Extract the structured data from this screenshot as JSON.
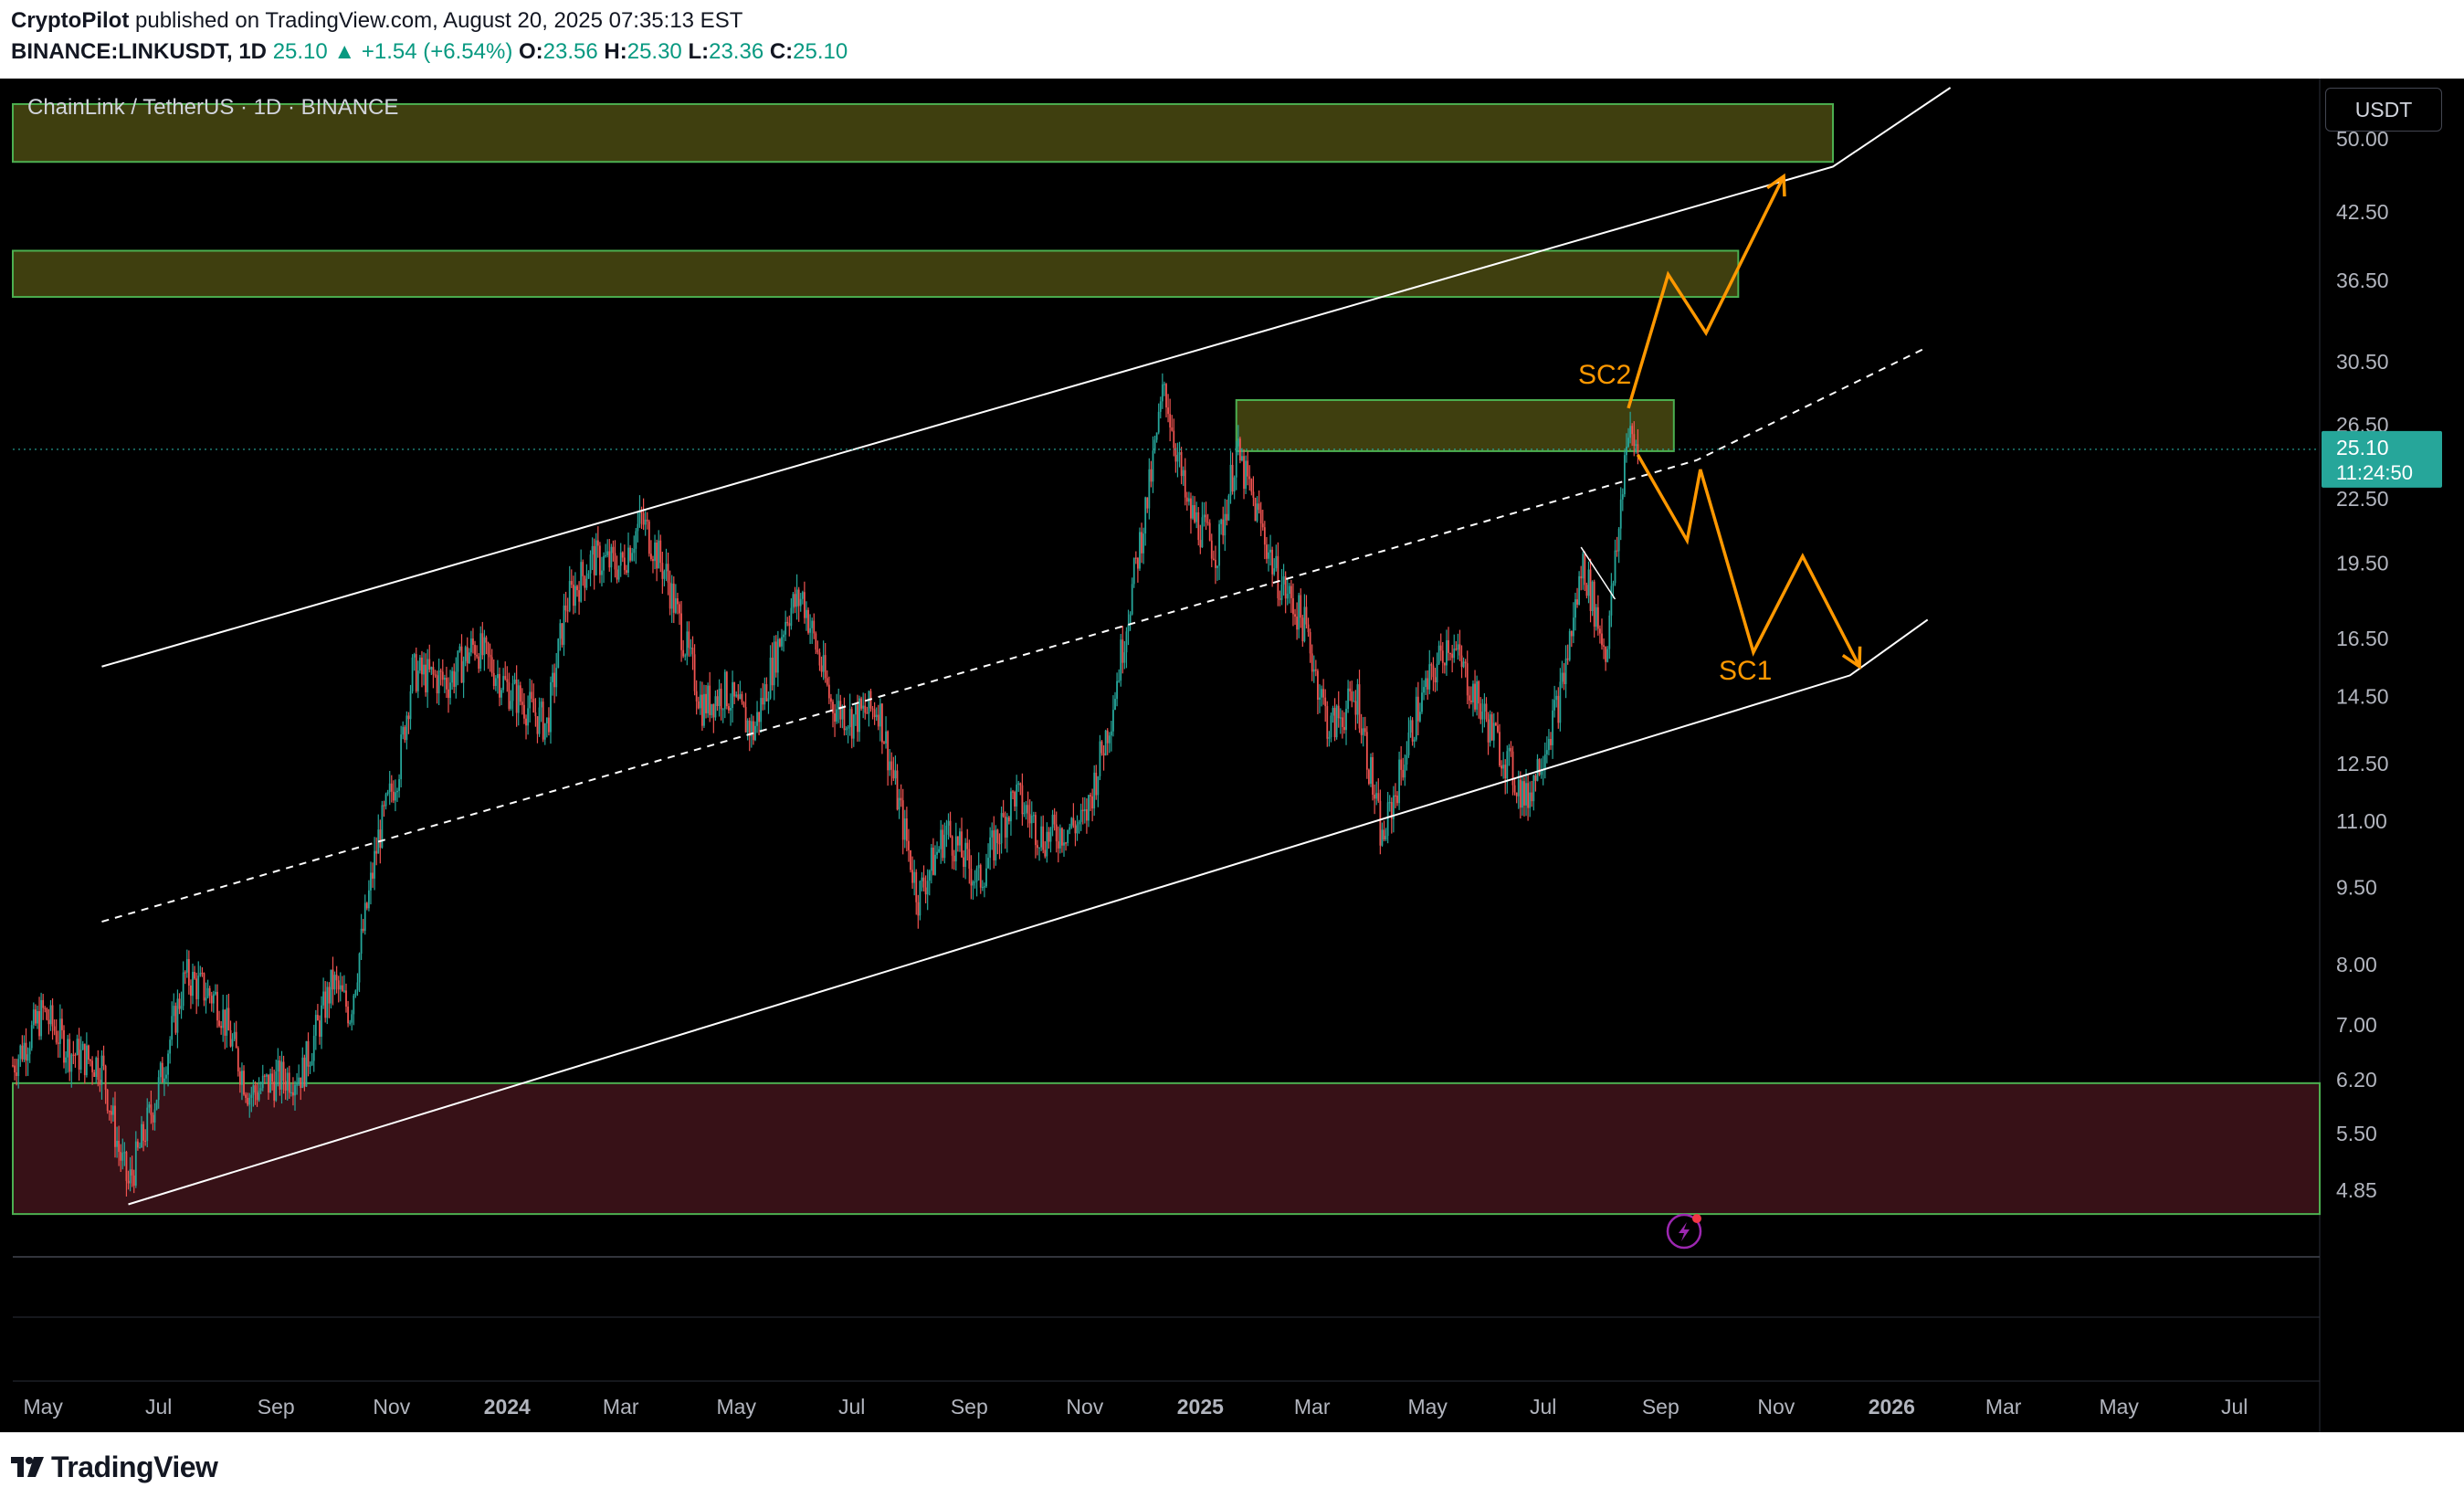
{
  "header": {
    "author": "CryptoPilot",
    "published": "published on TradingView.com, August 20, 2025 07:35:13 EST",
    "symbol": "BINANCE:LINKUSDT, 1D",
    "last": "25.10",
    "change": "+1.54 (+6.54%)",
    "o_label": "O:",
    "o_val": "23.56",
    "h_label": "H:",
    "h_val": "25.30",
    "l_label": "L:",
    "l_val": "23.36",
    "c_label": "C:",
    "c_val": "25.10"
  },
  "chart_title": "ChainLink / TetherUS · 1D · BINANCE",
  "currency_button": "USDT",
  "price_tag": {
    "price": "25.10",
    "countdown": "11:24:50"
  },
  "footer": {
    "brand": "TradingView"
  },
  "colors": {
    "up": "#26a69a",
    "down": "#ef5350",
    "background": "#000000",
    "price_tag": "#26a69a",
    "annotation": "#ff9800",
    "zone_yellow": "#4a4a12",
    "zone_red": "#3a1218",
    "zone_border": "#4caf50"
  },
  "chart_data": {
    "type": "candlestick",
    "scale": "log",
    "symbol": "LINKUSDT",
    "timeframe": "1D",
    "ylim": [
      4.2,
      56
    ],
    "x_range": [
      "2023-04-15",
      "2026-08-15"
    ],
    "y_ticks": [
      "50.00",
      "42.50",
      "36.50",
      "30.50",
      "26.50",
      "22.50",
      "19.50",
      "16.50",
      "14.50",
      "12.50",
      "11.00",
      "9.50",
      "8.00",
      "7.00",
      "6.20",
      "5.50",
      "4.85"
    ],
    "x_ticks": [
      {
        "label": "May",
        "date": "2023-05-01"
      },
      {
        "label": "Jul",
        "date": "2023-07-01"
      },
      {
        "label": "Sep",
        "date": "2023-09-01"
      },
      {
        "label": "Nov",
        "date": "2023-11-01"
      },
      {
        "label": "2024",
        "date": "2024-01-01",
        "bold": true
      },
      {
        "label": "Mar",
        "date": "2024-03-01"
      },
      {
        "label": "May",
        "date": "2024-05-01"
      },
      {
        "label": "Jul",
        "date": "2024-07-01"
      },
      {
        "label": "Sep",
        "date": "2024-09-01"
      },
      {
        "label": "Nov",
        "date": "2024-11-01"
      },
      {
        "label": "2025",
        "date": "2025-01-01",
        "bold": true
      },
      {
        "label": "Mar",
        "date": "2025-03-01"
      },
      {
        "label": "May",
        "date": "2025-05-01"
      },
      {
        "label": "Jul",
        "date": "2025-07-01"
      },
      {
        "label": "Sep",
        "date": "2025-09-01"
      },
      {
        "label": "Nov",
        "date": "2025-11-01"
      },
      {
        "label": "2026",
        "date": "2026-01-01",
        "bold": true
      },
      {
        "label": "Mar",
        "date": "2026-03-01"
      },
      {
        "label": "May",
        "date": "2026-05-01"
      },
      {
        "label": "Jul",
        "date": "2026-07-01"
      }
    ],
    "price_path": [
      [
        "2023-04-15",
        6.4
      ],
      [
        "2023-05-01",
        7.2
      ],
      [
        "2023-05-15",
        6.6
      ],
      [
        "2023-06-01",
        6.4
      ],
      [
        "2023-06-10",
        5.3
      ],
      [
        "2023-06-15",
        4.9
      ],
      [
        "2023-07-01",
        6.1
      ],
      [
        "2023-07-15",
        7.8
      ],
      [
        "2023-08-01",
        7.4
      ],
      [
        "2023-08-18",
        6.0
      ],
      [
        "2023-09-01",
        6.2
      ],
      [
        "2023-09-15",
        6.3
      ],
      [
        "2023-10-01",
        7.7
      ],
      [
        "2023-10-10",
        7.2
      ],
      [
        "2023-10-25",
        10.6
      ],
      [
        "2023-11-05",
        12.5
      ],
      [
        "2023-11-12",
        15.3
      ],
      [
        "2023-12-01",
        15.0
      ],
      [
        "2023-12-15",
        16.3
      ],
      [
        "2024-01-01",
        14.8
      ],
      [
        "2024-01-22",
        13.6
      ],
      [
        "2024-02-01",
        17.8
      ],
      [
        "2024-02-15",
        19.7
      ],
      [
        "2024-03-01",
        19.4
      ],
      [
        "2024-03-12",
        21.5
      ],
      [
        "2024-03-25",
        19.0
      ],
      [
        "2024-04-13",
        14.2
      ],
      [
        "2024-04-25",
        14.7
      ],
      [
        "2024-05-10",
        13.4
      ],
      [
        "2024-05-28",
        17.5
      ],
      [
        "2024-06-05",
        18.1
      ],
      [
        "2024-06-20",
        14.3
      ],
      [
        "2024-07-01",
        13.8
      ],
      [
        "2024-07-15",
        14.2
      ],
      [
        "2024-08-05",
        9.3
      ],
      [
        "2024-08-20",
        10.8
      ],
      [
        "2024-09-06",
        9.6
      ],
      [
        "2024-09-25",
        11.7
      ],
      [
        "2024-10-10",
        10.6
      ],
      [
        "2024-11-01",
        11.0
      ],
      [
        "2024-11-15",
        14.0
      ],
      [
        "2024-11-25",
        18.0
      ],
      [
        "2024-12-05",
        23.0
      ],
      [
        "2024-12-13",
        29.0
      ],
      [
        "2024-12-25",
        22.0
      ],
      [
        "2025-01-10",
        20.0
      ],
      [
        "2025-01-20",
        25.0
      ],
      [
        "2025-02-01",
        21.5
      ],
      [
        "2025-02-10",
        19.0
      ],
      [
        "2025-02-25",
        17.0
      ],
      [
        "2025-03-10",
        13.5
      ],
      [
        "2025-03-25",
        14.5
      ],
      [
        "2025-04-07",
        10.5
      ],
      [
        "2025-04-25",
        14.0
      ],
      [
        "2025-05-12",
        16.5
      ],
      [
        "2025-05-30",
        14.0
      ],
      [
        "2025-06-22",
        11.5
      ],
      [
        "2025-07-10",
        14.5
      ],
      [
        "2025-07-22",
        19.5
      ],
      [
        "2025-08-03",
        16.0
      ],
      [
        "2025-08-10",
        21.0
      ],
      [
        "2025-08-14",
        26.0
      ],
      [
        "2025-08-20",
        25.1
      ]
    ],
    "zones": [
      {
        "from": "2023-04-15",
        "to": "2025-12-01",
        "low": 47.5,
        "high": 54.0,
        "color": "yellow"
      },
      {
        "from": "2023-04-15",
        "to": "2025-10-12",
        "low": 35.2,
        "high": 39.0,
        "color": "yellow"
      },
      {
        "from": "2025-01-20",
        "to": "2025-09-08",
        "low": 25.0,
        "high": 28.0,
        "color": "yellow"
      },
      {
        "from": "2023-04-15",
        "to": "2026-08-15",
        "low": 4.6,
        "high": 6.15,
        "color": "red"
      }
    ],
    "channel": {
      "upper": [
        [
          "2023-06-01",
          15.5
        ],
        [
          "2025-12-01",
          47.0
        ],
        [
          "2026-02-01",
          56.0
        ]
      ],
      "middle": [
        [
          "2023-06-01",
          8.8
        ],
        [
          "2025-09-20",
          24.5
        ],
        [
          "2026-01-20",
          31.5
        ]
      ],
      "lower": [
        [
          "2023-06-15",
          4.7
        ],
        [
          "2025-12-10",
          15.2
        ],
        [
          "2026-01-20",
          17.2
        ]
      ]
    },
    "scenarios": [
      {
        "name": "SC2",
        "path": [
          [
            "2025-08-15",
            27.5
          ],
          [
            "2025-09-05",
            37.0
          ],
          [
            "2025-09-25",
            32.5
          ],
          [
            "2025-11-05",
            46.0
          ]
        ]
      },
      {
        "name": "SC1",
        "path": [
          [
            "2025-08-20",
            24.8
          ],
          [
            "2025-09-15",
            20.5
          ],
          [
            "2025-09-22",
            24.0
          ],
          [
            "2025-10-20",
            16.0
          ],
          [
            "2025-11-15",
            19.8
          ],
          [
            "2025-12-15",
            15.5
          ]
        ]
      }
    ]
  }
}
